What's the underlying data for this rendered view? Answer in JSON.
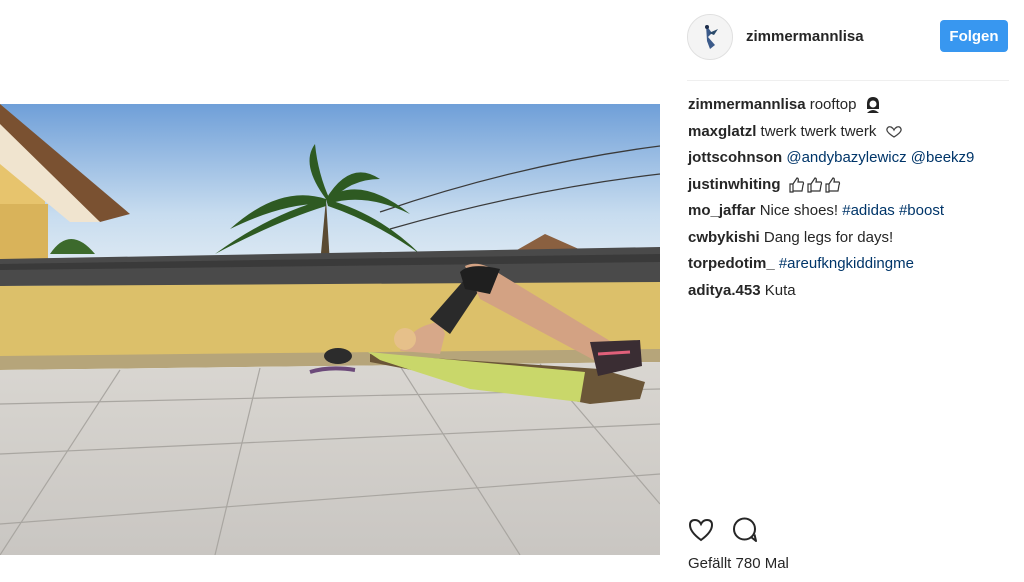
{
  "post": {
    "username": "zimmermannlisa",
    "follow_label": "Folgen"
  },
  "comments": [
    {
      "user": "zimmermannlisa",
      "text": "rooftop",
      "emoji": "woman-emoji"
    },
    {
      "user": "maxglatzl",
      "text": "twerk twerk twerk",
      "emoji": "heart-emoji"
    },
    {
      "user": "jottscohnson",
      "mentions": [
        "@andybazylewicz",
        "@beekz9"
      ]
    },
    {
      "user": "justinwhiting",
      "emoji": "thumbs-up-emoji x3"
    },
    {
      "user": "mo_jaffar",
      "text": "Nice shoes!",
      "hashtags": [
        "#adidas",
        "#boost"
      ]
    },
    {
      "user": "cwbykishi",
      "text": "Dang legs for days!"
    },
    {
      "user": "torpedotim_",
      "hashtags": [
        "#areufkngkiddingme"
      ]
    },
    {
      "user": "aditya.453",
      "text": "Kuta"
    }
  ],
  "likes": {
    "label": "Gefällt 780 Mal"
  },
  "icons": {
    "like": "heart-outline-icon",
    "comment": "speech-bubble-icon"
  },
  "colors": {
    "follow_button": "#3897f0",
    "link": "#003569",
    "text": "#262626"
  }
}
